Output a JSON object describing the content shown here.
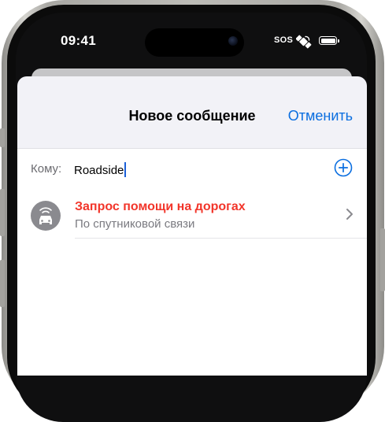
{
  "status_bar": {
    "time": "09:41",
    "sos": "SOS",
    "icons": [
      "satellite-icon",
      "battery-icon"
    ]
  },
  "sheet": {
    "title": "Новое сообщение",
    "cancel_label": "Отменить"
  },
  "to_field": {
    "label": "Кому:",
    "value": "Roadside",
    "add_icon": "plus-circle-icon"
  },
  "suggestion": {
    "title": "Запрос помощи на дорогах",
    "subtitle": "По спутниковой связи",
    "icon": "car-signal-icon",
    "chevron": "chevron-right-icon"
  },
  "colors": {
    "accent": "#0a6ee0",
    "title_red": "#f2352a",
    "sheet_bg": "#f2f2f7"
  }
}
